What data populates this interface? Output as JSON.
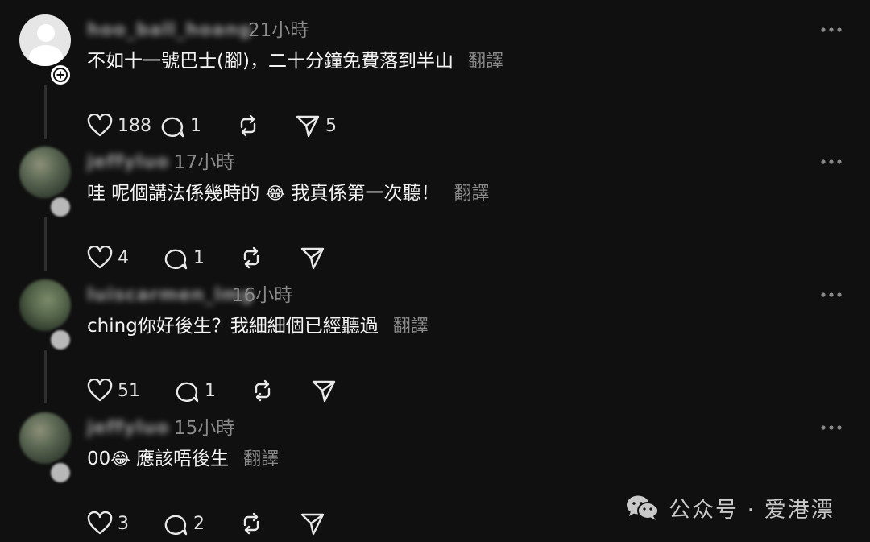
{
  "posts": [
    {
      "username": "hoo_ball_hoang",
      "time": "21小時",
      "content": "不如十一號巴士(腳)，二十分鐘免費落到半山",
      "emoji": "",
      "content_after": "",
      "translate": "翻譯",
      "likes": "188",
      "replies": "1",
      "reposts": "",
      "shares": "5"
    },
    {
      "username": "jeffyluo",
      "time": "17小時",
      "content": "哇 呢個講法係幾時的",
      "emoji": "😂",
      "content_after": "我真係第一次聽！",
      "translate": "翻譯",
      "likes": "4",
      "replies": "1",
      "reposts": "",
      "shares": ""
    },
    {
      "username": "luiscarmen_lmg",
      "time": "16小時",
      "content": "ching你好後生？我細細個已經聽過",
      "emoji": "",
      "content_after": "",
      "translate": "翻譯",
      "likes": "51",
      "replies": "1",
      "reposts": "",
      "shares": ""
    },
    {
      "username": "jeffyluo",
      "time": "15小時",
      "content": "00",
      "emoji": "😂",
      "content_after": "應該唔後生",
      "translate": "翻譯",
      "likes": "3",
      "replies": "2",
      "reposts": "",
      "shares": ""
    }
  ],
  "icons": {
    "like": "heart-icon",
    "reply": "comment-icon",
    "repost": "repost-icon",
    "share": "send-icon",
    "more": "more-dots-icon",
    "follow": "plus-icon"
  },
  "watermark": {
    "label": "公众号 · 爱港漂",
    "icon": "wechat-icon"
  },
  "colors": {
    "background": "#101010",
    "text": "#f3f3f3",
    "secondary": "#8a8a8a"
  }
}
